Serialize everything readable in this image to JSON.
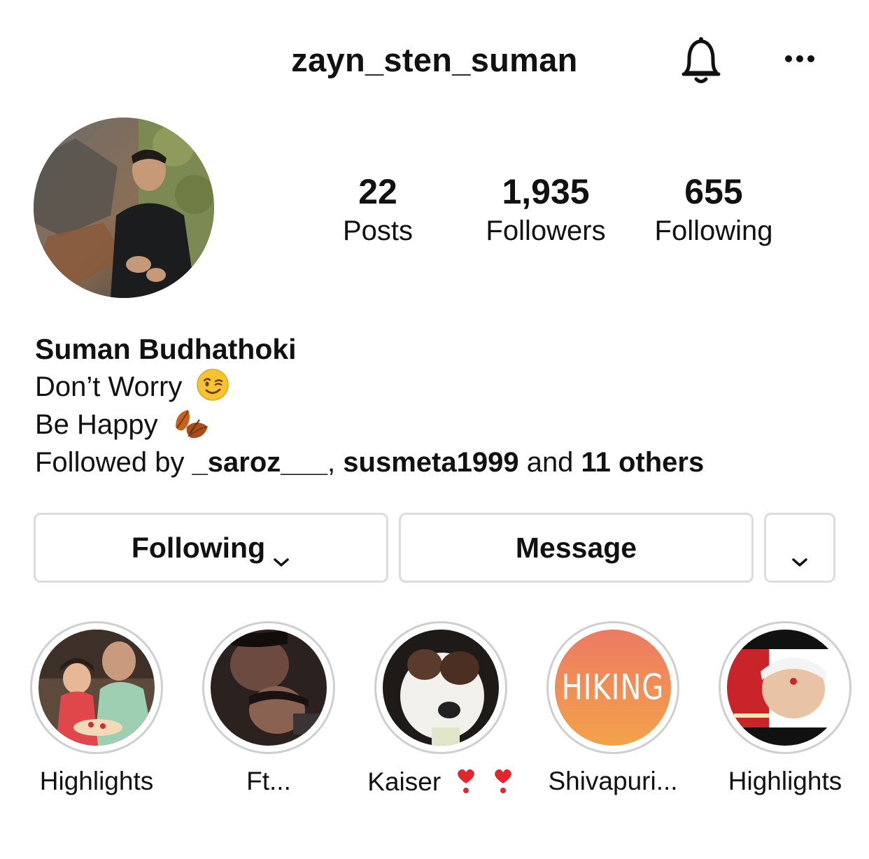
{
  "header": {
    "username": "zayn_sten_suman",
    "bell_icon": "bell-icon",
    "more_icon": "more-horizontal-icon"
  },
  "stats": {
    "posts": {
      "value": "22",
      "label": "Posts"
    },
    "followers": {
      "value": "1,935",
      "label": "Followers"
    },
    "following": {
      "value": "655",
      "label": "Following"
    }
  },
  "bio": {
    "name": "Suman Budhathoki",
    "line1": "Don’t Worry",
    "line1_emoji": "winking-face",
    "line2": "Be Happy",
    "line2_emoji": "fallen-leaf",
    "followed_by_prefix": "Followed by ",
    "follower1": "_saroz___",
    "separator": ", ",
    "follower2": "susmeta1999",
    "and_text": " and ",
    "others": "11 others"
  },
  "actions": {
    "following_label": "Following",
    "message_label": "Message",
    "more_icon": "chevron-down-icon"
  },
  "highlights": [
    {
      "label": "Highlights"
    },
    {
      "label": "Ft..."
    },
    {
      "label": "Kaiser",
      "suffix_icons": [
        "heart-exclamation-icon",
        "heart-exclamation-icon"
      ]
    },
    {
      "label": "Shivapuri...",
      "cover_text": "HIKING"
    },
    {
      "label": "Highlights"
    }
  ],
  "colors": {
    "text": "#111111",
    "border": "#dcdcdc",
    "ring": "#cfcfcf",
    "hiking_gradient_top": "#ee7a63",
    "hiking_gradient_bottom": "#f2a24a",
    "heart_red": "#e0262f"
  }
}
